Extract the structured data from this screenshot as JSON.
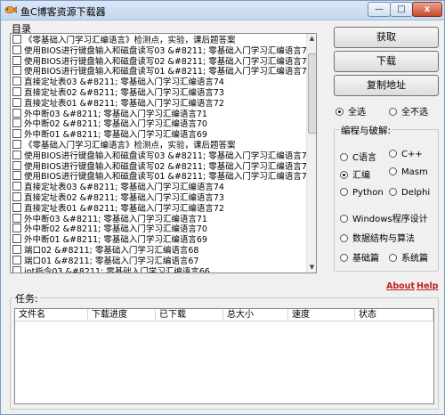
{
  "window": {
    "title": "鱼C博客资源下载器",
    "min_glyph": "—",
    "max_glyph": "□",
    "close_glyph": "x"
  },
  "catalog": {
    "label": "目录",
    "items": [
      "《零基础入门学习汇编语言》检测点，实验，课后题答案",
      "使用BIOS进行键盘输入和磁盘读写03 &#8211; 零基础入门学习汇编语言7",
      "使用BIOS进行键盘输入和磁盘读写02 &#8211; 零基础入门学习汇编语言7",
      "使用BIOS进行键盘输入和磁盘读写01 &#8211; 零基础入门学习汇编语言7",
      "直接定址表03 &#8211; 零基础入门学习汇编语言74",
      "直接定址表02 &#8211; 零基础入门学习汇编语言73",
      "直接定址表01 &#8211; 零基础入门学习汇编语言72",
      "外中断03 &#8211; 零基础入门学习汇编语言71",
      "外中断02 &#8211; 零基础入门学习汇编语言70",
      "外中断01 &#8211; 零基础入门学习汇编语言69",
      "《零基础入门学习汇编语言》检测点，实验，课后题答案",
      "使用BIOS进行键盘输入和磁盘读写03 &#8211; 零基础入门学习汇编语言7",
      "使用BIOS进行键盘输入和磁盘读写02 &#8211; 零基础入门学习汇编语言7",
      "使用BIOS进行键盘输入和磁盘读写01 &#8211; 零基础入门学习汇编语言7",
      "直接定址表03 &#8211; 零基础入门学习汇编语言74",
      "直接定址表02 &#8211; 零基础入门学习汇编语言73",
      "直接定址表01 &#8211; 零基础入门学习汇编语言72",
      "外中断03 &#8211; 零基础入门学习汇编语言71",
      "外中断02 &#8211; 零基础入门学习汇编语言70",
      "外中断01 &#8211; 零基础入门学习汇编语言69",
      "端口02 &#8211; 零基础入门学习汇编语言68",
      "端口01 &#8211; 零基础入门学习汇编语言67",
      "int指令03 &#8211; 零基础入门学习汇编语言66"
    ]
  },
  "buttons": {
    "fetch": "获取",
    "download": "下载",
    "copy_address": "复制地址"
  },
  "selection": {
    "select_all": "全选",
    "select_none": "全不选",
    "selected": "select_all"
  },
  "category": {
    "title": "编程与破解:",
    "options": [
      "C语言",
      "C++",
      "汇编",
      "Masm",
      "Python",
      "Delphi",
      "Windows程序设计",
      "数据结构与算法",
      "基础篇",
      "系统篇"
    ],
    "selected": "汇编"
  },
  "links": {
    "about": "About",
    "help": "Help"
  },
  "tasks": {
    "label": "任务:",
    "columns": [
      "文件名",
      "下载进度",
      "已下载",
      "总大小",
      "速度",
      "状态"
    ]
  },
  "colors": {
    "link": "#c02020",
    "titlebar": "#c3d7ef",
    "close": "#c9482b"
  }
}
